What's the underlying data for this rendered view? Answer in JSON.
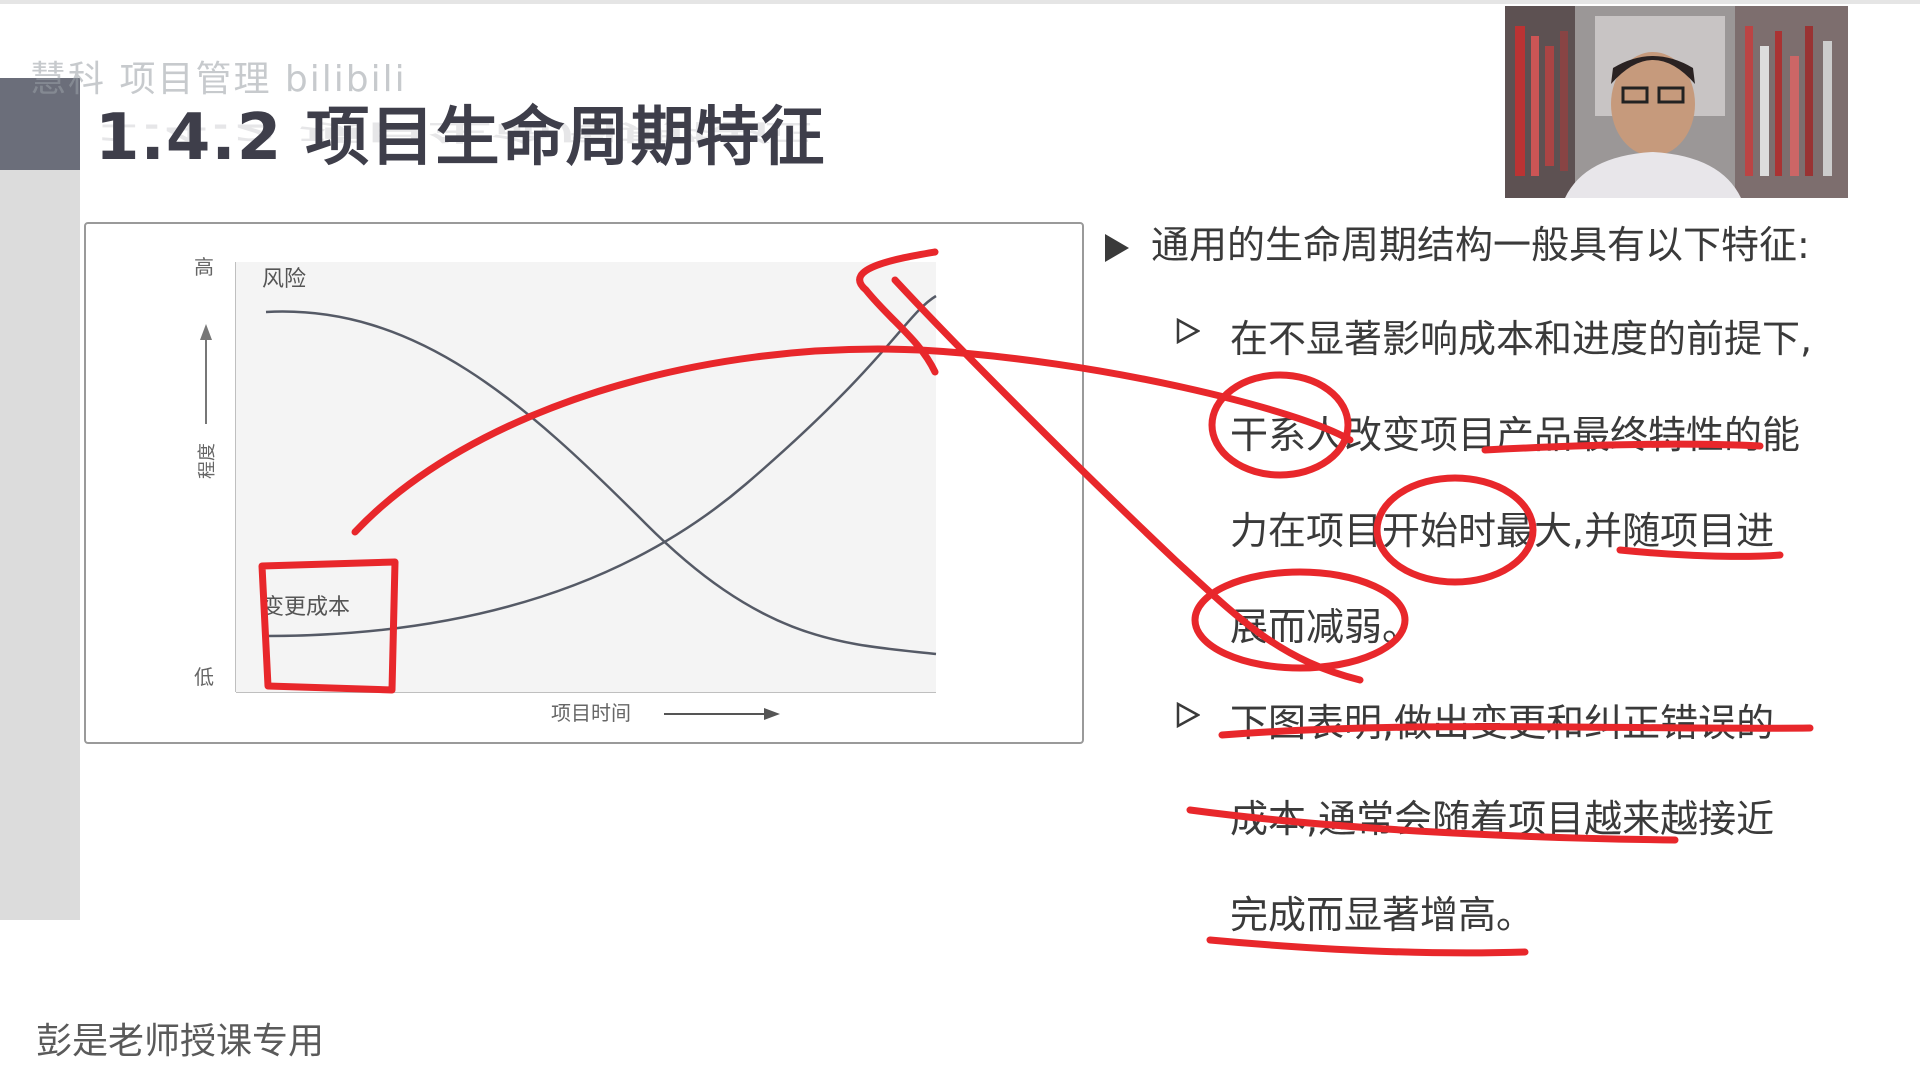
{
  "watermark": "慧科 项目管理 bilibili",
  "slide_title": "1.4.2 项目生命周期特征",
  "chart": {
    "y_high": "高",
    "y_low": "低",
    "y_label": "程度",
    "x_label": "项目时间",
    "risk_label": "风险",
    "change_cost_label": "变更成本"
  },
  "bullets": {
    "main": "通用的生命周期结构一般具有以下特征:",
    "sub1_lines": [
      "在不显著影响成本和进度的前提下,",
      "干系人改变项目产品最终特性的能",
      "力在项目开始时最大,并随项目进",
      "展而减弱。"
    ],
    "sub2_lines": [
      "下图表明,做出变更和纠正错误的",
      "成本,通常会随着项目越来越接近",
      "完成而显著增高。"
    ]
  },
  "footer": "彭是老师授课专用",
  "colors": {
    "annotation": "#e8272b",
    "title": "#3e3e4a",
    "curve": "#555a66"
  }
}
